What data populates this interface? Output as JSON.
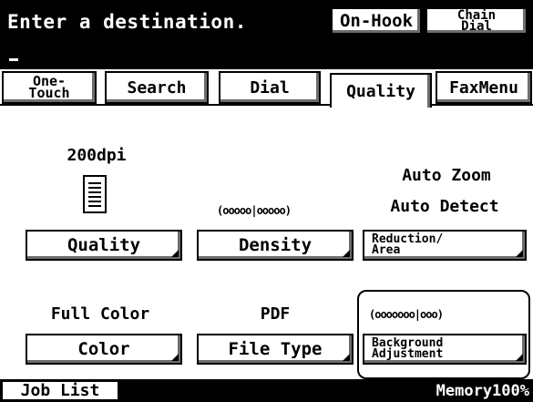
{
  "header": {
    "prompt": "Enter a destination.",
    "on_hook": "On-Hook",
    "chain_dial": [
      "Chain",
      "Dial"
    ]
  },
  "tabs": {
    "one_touch": [
      "One-",
      "Touch"
    ],
    "search": "Search",
    "dial": "Dial",
    "quality": "Quality",
    "fax_menu": "FaxMenu",
    "active": "Quality"
  },
  "settings": {
    "resolution": "200dpi",
    "quality_button": "Quality",
    "density_meter": "(ooooo|ooooo)",
    "density_level": 0.5,
    "density_button": "Density",
    "zoom": "Auto Zoom",
    "detect": "Auto Detect",
    "reduction_button": [
      "Reduction/",
      "Area"
    ],
    "color_mode": "Full Color",
    "color_button": "Color",
    "file_format": "PDF",
    "file_type_button": "File Type",
    "background_meter": "(ooooooo|ooo)",
    "background_level": 0.7,
    "background_button": [
      "Background",
      "Adjustment"
    ]
  },
  "footer": {
    "job_list": "Job List",
    "memory": "Memory100%"
  }
}
